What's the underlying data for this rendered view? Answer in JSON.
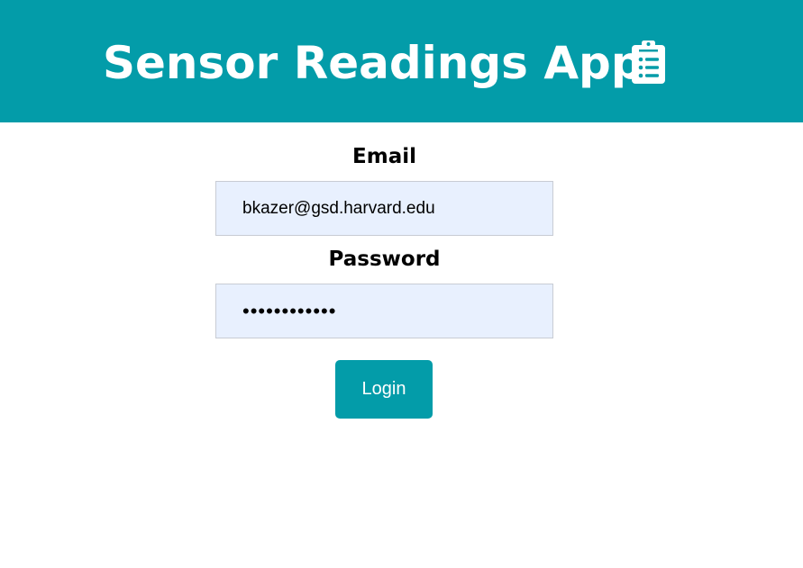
{
  "header": {
    "title": "Sensor Readings App",
    "icon": "clipboard-list-icon",
    "background_color": "#039ca9"
  },
  "form": {
    "email_label": "Email",
    "email_value": "bkazer@gsd.harvard.edu",
    "password_label": "Password",
    "password_value": "••••••••••••",
    "input_background_color": "#e8f0fe",
    "login_label": "Login",
    "button_color": "#039ca9"
  }
}
